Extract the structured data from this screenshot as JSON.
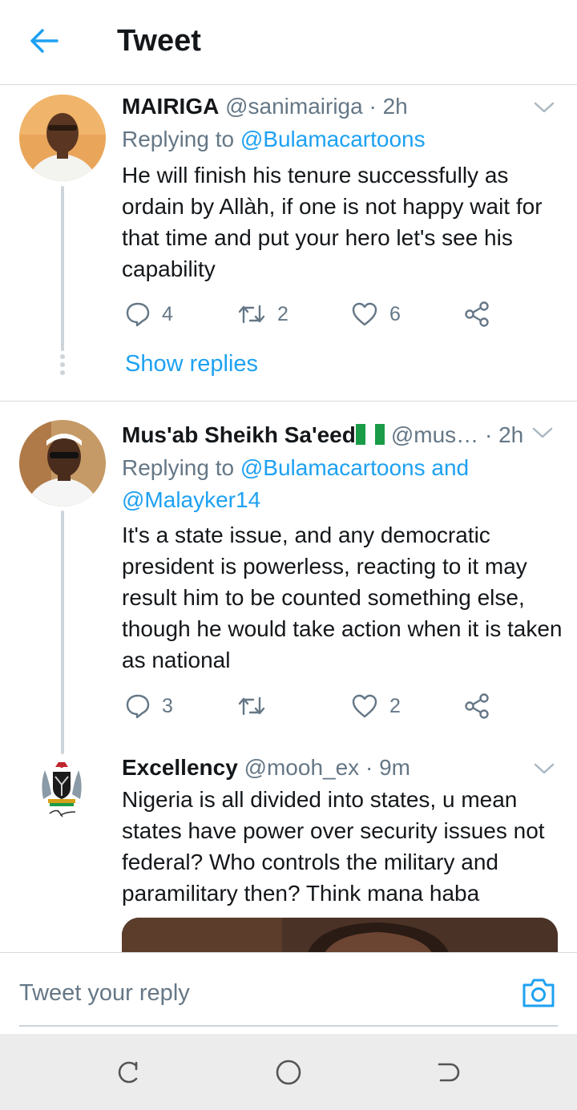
{
  "header": {
    "title": "Tweet",
    "back_icon": "arrow-left-icon",
    "accent_color": "#1da1f2"
  },
  "tweets": [
    {
      "name": "MAIRIGA",
      "handle": "@sanimairiga",
      "sep": "·",
      "time": "2h",
      "replying_prefix": "Replying to ",
      "replying_to": "@Bulamacartoons",
      "text": "He will finish his tenure successfully as ordain by Allàh, if one is not happy wait for that time and put your hero let's see his capability",
      "replies": "4",
      "retweets": "2",
      "likes": "6",
      "show_replies": "Show replies"
    },
    {
      "name": "Mus'ab Sheikh Sa'eed",
      "flag": "🇳🇬",
      "handle": "@mus…",
      "sep": "·",
      "time": "2h",
      "replying_prefix": "Replying to ",
      "replying_to": "@Bulamacartoons and",
      "replying_to_2": "@Malayker14",
      "text": "It's a state issue, and any democratic president is powerless, reacting to it may result him to be counted something else, though he would take action when it is taken as national",
      "replies": "3",
      "retweets": "",
      "likes": "2"
    },
    {
      "name": "Excellency",
      "handle": "@mooh_ex",
      "sep": "·",
      "time": "9m",
      "text": "Nigeria is all divided into states, u mean states have power over security issues not federal? Who controls the military and paramilitary then? Think mana haba"
    }
  ],
  "reply_bar": {
    "placeholder": "Tweet your reply",
    "camera_icon": "camera-icon"
  },
  "navbar": {
    "recents_icon": "recents-icon",
    "home_icon": "home-circle-icon",
    "back_icon": "back-nav-icon"
  }
}
